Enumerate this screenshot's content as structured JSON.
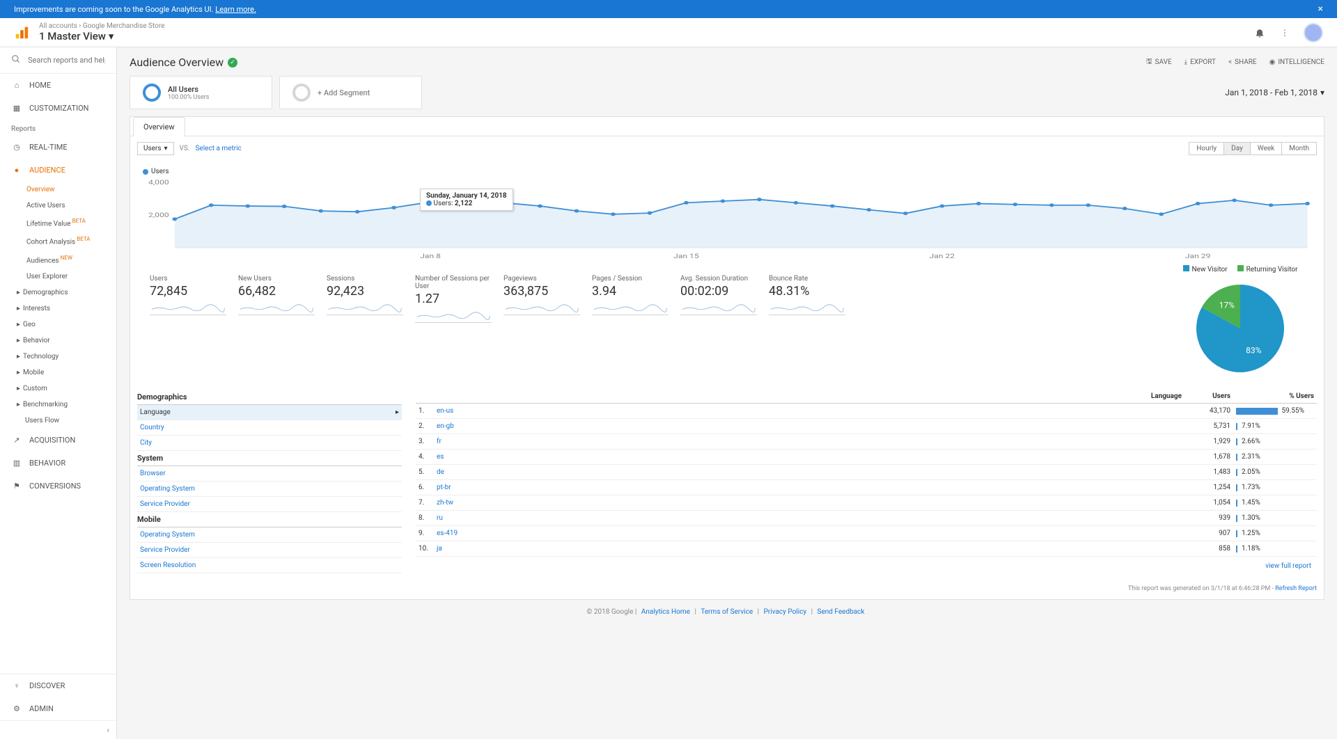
{
  "banner": {
    "text": "Improvements are coming soon to the Google Analytics UI.",
    "link": "Learn more."
  },
  "breadcrumb": {
    "accounts": "All accounts",
    "store": "Google Merchandise Store",
    "view": "1 Master View"
  },
  "search": {
    "placeholder": "Search reports and help"
  },
  "nav": {
    "home": "HOME",
    "custom": "CUSTOMIZATION",
    "reports": "Reports",
    "realtime": "REAL-TIME",
    "audience": "AUDIENCE",
    "acquisition": "ACQUISITION",
    "behavior": "BEHAVIOR",
    "conversions": "CONVERSIONS",
    "discover": "DISCOVER",
    "admin": "ADMIN"
  },
  "audience_sub": [
    {
      "label": "Overview",
      "active": true
    },
    {
      "label": "Active Users"
    },
    {
      "label": "Lifetime Value",
      "badge": "BETA"
    },
    {
      "label": "Cohort Analysis",
      "badge": "BETA"
    },
    {
      "label": "Audiences",
      "badge": "NEW"
    },
    {
      "label": "User Explorer"
    }
  ],
  "audience_groups": [
    "Demographics",
    "Interests",
    "Geo",
    "Behavior",
    "Technology",
    "Mobile",
    "Custom",
    "Benchmarking",
    "Users Flow"
  ],
  "page": {
    "title": "Audience Overview"
  },
  "actions": {
    "save": "SAVE",
    "export": "EXPORT",
    "share": "SHARE",
    "intel": "INTELLIGENCE"
  },
  "segment": {
    "all_users": "All Users",
    "all_users_sub": "100.00% Users",
    "add": "+ Add Segment"
  },
  "date_range": "Jan 1, 2018 - Feb 1, 2018",
  "tab": "Overview",
  "metric_dd": "Users",
  "vs": "VS.",
  "select_metric": "Select a metric",
  "time_toggles": [
    "Hourly",
    "Day",
    "Week",
    "Month"
  ],
  "time_active": 1,
  "chart_legend": "Users",
  "tooltip": {
    "date": "Sunday, January 14, 2018",
    "metric": "Users:",
    "value": "2,122"
  },
  "chart_data": {
    "type": "line",
    "ylabel": "Users",
    "yticks": [
      2000,
      4000
    ],
    "x_categories": [
      "Jan 8",
      "Jan 15",
      "Jan 22",
      "Jan 29"
    ],
    "values": [
      1750,
      2600,
      2550,
      2530,
      2250,
      2200,
      2450,
      2800,
      2850,
      2750,
      2550,
      2250,
      2050,
      2122,
      2750,
      2850,
      2950,
      2750,
      2550,
      2320,
      2100,
      2550,
      2700,
      2650,
      2600,
      2600,
      2400,
      2050,
      2700,
      2900,
      2600,
      2700
    ]
  },
  "scorecards": [
    {
      "label": "Users",
      "value": "72,845"
    },
    {
      "label": "New Users",
      "value": "66,482"
    },
    {
      "label": "Sessions",
      "value": "92,423"
    },
    {
      "label": "Number of Sessions per User",
      "value": "1.27"
    },
    {
      "label": "Pageviews",
      "value": "363,875"
    },
    {
      "label": "Pages / Session",
      "value": "3.94"
    },
    {
      "label": "Avg. Session Duration",
      "value": "00:02:09"
    },
    {
      "label": "Bounce Rate",
      "value": "48.31%"
    }
  ],
  "pie": {
    "new_label": "New Visitor",
    "return_label": "Returning Visitor",
    "slices": [
      {
        "label": "83%",
        "value": 83,
        "color": "#2196c8"
      },
      {
        "label": "17%",
        "value": 17,
        "color": "#4caf50"
      }
    ]
  },
  "dim_left": {
    "groups": [
      {
        "header": "Demographics",
        "rows": [
          {
            "label": "Language",
            "sel": true
          },
          {
            "label": "Country",
            "link": true
          },
          {
            "label": "City",
            "link": true
          }
        ]
      },
      {
        "header": "System",
        "rows": [
          {
            "label": "Browser",
            "link": true
          },
          {
            "label": "Operating System",
            "link": true
          },
          {
            "label": "Service Provider",
            "link": true
          }
        ]
      },
      {
        "header": "Mobile",
        "rows": [
          {
            "label": "Operating System",
            "link": true
          },
          {
            "label": "Service Provider",
            "link": true
          },
          {
            "label": "Screen Resolution",
            "link": true
          }
        ]
      }
    ]
  },
  "lang_table": {
    "dim_label": "Language",
    "col_users": "Users",
    "col_pct": "% Users",
    "rows": [
      {
        "n": "1.",
        "lang": "en-us",
        "users": "43,170",
        "pct": "59.55%",
        "bar": 59.55
      },
      {
        "n": "2.",
        "lang": "en-gb",
        "users": "5,731",
        "pct": "7.91%",
        "bar": 7.91
      },
      {
        "n": "3.",
        "lang": "fr",
        "users": "1,929",
        "pct": "2.66%",
        "bar": 2.66
      },
      {
        "n": "4.",
        "lang": "es",
        "users": "1,678",
        "pct": "2.31%",
        "bar": 2.31
      },
      {
        "n": "5.",
        "lang": "de",
        "users": "1,483",
        "pct": "2.05%",
        "bar": 2.05
      },
      {
        "n": "6.",
        "lang": "pt-br",
        "users": "1,254",
        "pct": "1.73%",
        "bar": 1.73
      },
      {
        "n": "7.",
        "lang": "zh-tw",
        "users": "1,054",
        "pct": "1.45%",
        "bar": 1.45
      },
      {
        "n": "8.",
        "lang": "ru",
        "users": "939",
        "pct": "1.30%",
        "bar": 1.3
      },
      {
        "n": "9.",
        "lang": "es-419",
        "users": "907",
        "pct": "1.25%",
        "bar": 1.25
      },
      {
        "n": "10.",
        "lang": "ja",
        "users": "858",
        "pct": "1.18%",
        "bar": 1.18
      }
    ],
    "full_report": "view full report"
  },
  "report_footer": {
    "text": "This report was generated on 3/1/18 at 6:46:28 PM -",
    "link": "Refresh Report"
  },
  "footer": {
    "copyright": "© 2018 Google",
    "links": [
      "Analytics Home",
      "Terms of Service",
      "Privacy Policy",
      "Send Feedback"
    ]
  }
}
